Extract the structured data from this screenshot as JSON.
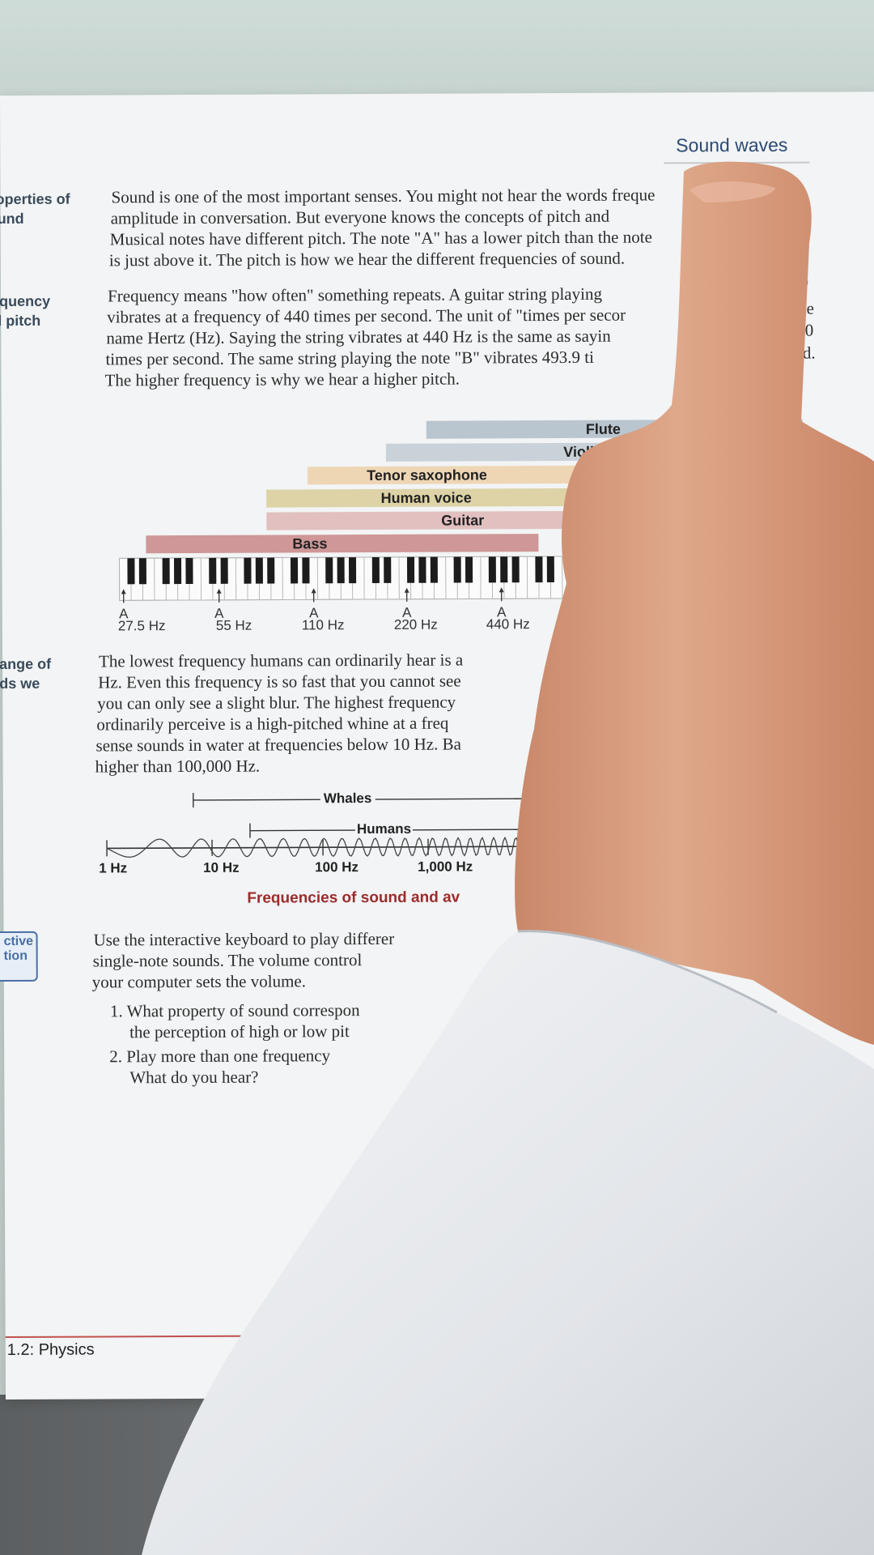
{
  "header": {
    "title": "Sound waves"
  },
  "sidebar": {
    "properties": [
      "operties of",
      "und"
    ],
    "frequency": [
      "quency",
      "l pitch"
    ],
    "range": [
      "ange of",
      "ds we"
    ],
    "interactive": [
      "ctive",
      "tion"
    ]
  },
  "paragraphs": {
    "intro": [
      "Sound is one of the most important senses. You might not hear the words freque",
      "amplitude in conversation. But everyone knows the concepts of pitch and",
      "Musical notes have different pitch. The note \"A\" has a lower pitch than the note",
      "is just above it. The pitch is how we hear the different frequencies of sound."
    ],
    "frequency": [
      "Frequency means \"how often\" something repeats. A guitar string playing",
      "vibrates at a frequency of 440 times per second. The unit of \"times per secor",
      "name Hertz (Hz). Saying the string vibrates at 440 Hz is the same as sayin",
      "times per second. The same string playing the note \"B\" vibrates 493.9 ti",
      "The higher frequency is why we hear a higher pitch."
    ],
    "frequency_right_fragments": [
      "\"",
      "he",
      "40",
      "nd."
    ],
    "range": [
      "The lowest frequency humans can ordinarily hear is a",
      "Hz. Even this frequency is so fast that you cannot see",
      "you can only see a slight blur. The highest frequency",
      "ordinarily perceive is a high-pitched whine at a freq",
      "sense sounds in water at frequencies below 10 Hz. Ba",
      "higher than 100,000 Hz."
    ],
    "interactive": [
      "Use the interactive keyboard to play differer",
      "single-note sounds. The volume control",
      "your computer sets the volume."
    ],
    "questions": [
      "1. What property of sound correspon",
      "the perception of high or low pit",
      "2. Play more than one frequency",
      "What do you hear?"
    ]
  },
  "instrument_chart": {
    "bars": [
      {
        "label": "Flute",
        "color": "#b9c5cf"
      },
      {
        "label": "Violin",
        "color": "#c9d2d9"
      },
      {
        "label": "Tenor saxophone",
        "color": "#eed6b5"
      },
      {
        "label": "Human voice",
        "color": "#ddd3a6"
      },
      {
        "label": "Guitar",
        "color": "#e1c0bf"
      },
      {
        "label": "Bass",
        "color": "#cf9797"
      }
    ],
    "note_letter": "A",
    "frequencies": [
      "27.5 Hz",
      "55 Hz",
      "110 Hz",
      "220 Hz",
      "440 Hz"
    ]
  },
  "range_chart": {
    "ranges": [
      {
        "label": "Whales"
      },
      {
        "label": "Humans"
      }
    ],
    "axis": [
      "1 Hz",
      "10 Hz",
      "100 Hz",
      "1,000 Hz"
    ],
    "caption": "Frequencies of sound and av"
  },
  "footer": {
    "section": "1.2: Physics"
  },
  "colors": {
    "page": "#f2f4f5",
    "header_blue": "#2c4a73",
    "caption_red": "#9b2c2c",
    "skin": "#d9a07e",
    "sleeve": "#e9ebee"
  }
}
